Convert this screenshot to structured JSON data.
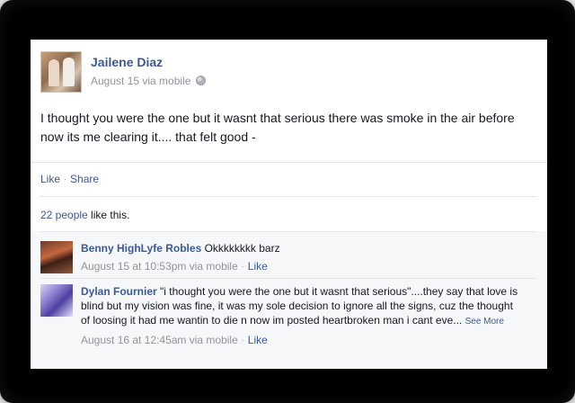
{
  "post": {
    "author": "Jailene Diaz",
    "meta": "August 15 via mobile",
    "text": "I thought you were the one but it wasnt that serious there was smoke in the air before now its me clearing it.... that felt good -"
  },
  "actions": {
    "like": "Like",
    "share": "Share"
  },
  "likes": {
    "count": "22 people",
    "suffix": " like this."
  },
  "comments": [
    {
      "author": "Benny HighLyfe Robles",
      "text": " Okkkkkkkk barz",
      "meta": "August 15 at 10:53pm via mobile",
      "like": "Like"
    },
    {
      "author": "Dylan Fournier",
      "text": " \"i thought you were the one but it wasnt that serious\"....they say that love is blind but my vision was fine, it was my sole decision to ignore all the signs, cuz the thought of loosing it had me wantin to die n now im posted heartbroken man i cant eve...",
      "see_more": "See More",
      "meta": "August 16 at 12:45am via mobile",
      "like": "Like"
    }
  ],
  "icons": {
    "audience": "globe-icon"
  }
}
